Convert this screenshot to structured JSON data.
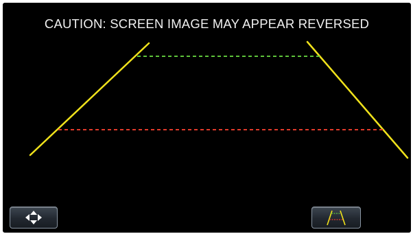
{
  "caution": {
    "text": "CAUTION: SCREEN IMAGE MAY APPEAR REVERSED"
  },
  "colors": {
    "background": "#000000",
    "side_guide": "#f0e21b",
    "far_guide": "#5ec43a",
    "near_guide": "#e23a2a",
    "caption": "#f0f0f0"
  },
  "buttons": {
    "adjust": {
      "icon": "four-way-arrows-icon"
    },
    "guide_toggle": {
      "icon": "parking-guide-icon"
    }
  }
}
